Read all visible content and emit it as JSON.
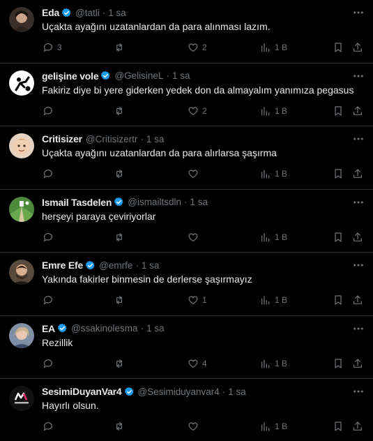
{
  "colors": {
    "background": "#000000",
    "text": "#e7e9ea",
    "muted": "#71767b",
    "divider": "#2f3336",
    "verified": "#1d9bf0"
  },
  "icons": {
    "reply": "comment-bubble-icon",
    "retweet": "retweet-icon",
    "like": "heart-icon",
    "views": "bar-chart-icon",
    "bookmark": "bookmark-icon",
    "share": "share-upload-icon",
    "more": "more-dots-icon",
    "verified": "verified-badge-icon"
  },
  "tweets": [
    {
      "name": "Eda",
      "verified": true,
      "handle": "@tatli",
      "dot": "·",
      "time": "1 sa",
      "text": "Uçakta ayağını uzatanlardan da para alınması lazım.",
      "replies": "3",
      "retweets": "",
      "likes": "2",
      "views": "1 B"
    },
    {
      "name": "gelişine vole",
      "verified": true,
      "handle": "@GelisineL",
      "dot": "·",
      "time": "1 sa",
      "text": "Fakiriz diye bi yere giderken yedek don da almayalım yanımıza pegasus",
      "replies": "",
      "retweets": "",
      "likes": "2",
      "views": "1 B"
    },
    {
      "name": "Critisizer",
      "verified": false,
      "handle": "@Critisizertr",
      "dot": "·",
      "time": "1 sa",
      "text": "Uçakta ayağını uzatanlardan da para alırlarsa şaşırma",
      "replies": "",
      "retweets": "",
      "likes": "",
      "views": "1 B"
    },
    {
      "name": "Ismail Tasdelen",
      "verified": true,
      "handle": "@ismailtsdln",
      "dot": "·",
      "time": "1 sa",
      "text": "herşeyi paraya çeviriyorlar",
      "replies": "",
      "retweets": "",
      "likes": "",
      "views": "1 B"
    },
    {
      "name": "Emre Efe",
      "verified": true,
      "handle": "@emrfe",
      "dot": "·",
      "time": "1 sa",
      "text": "Yakında fakirler binmesin de derlerse şaşırmayız",
      "replies": "",
      "retweets": "",
      "likes": "1",
      "views": "1 B"
    },
    {
      "name": "EA",
      "verified": true,
      "handle": "@ssakinolesma",
      "dot": "·",
      "time": "1 sa",
      "text": "Rezillik",
      "replies": "",
      "retweets": "",
      "likes": "4",
      "views": "1 B"
    },
    {
      "name": "SesimiDuyanVar4",
      "verified": true,
      "handle": "@Sesimiduyanvar4",
      "dot": "·",
      "time": "1 sa",
      "text": "Hayırlı olsun.",
      "replies": "",
      "retweets": "",
      "likes": "",
      "views": "1 B"
    }
  ]
}
